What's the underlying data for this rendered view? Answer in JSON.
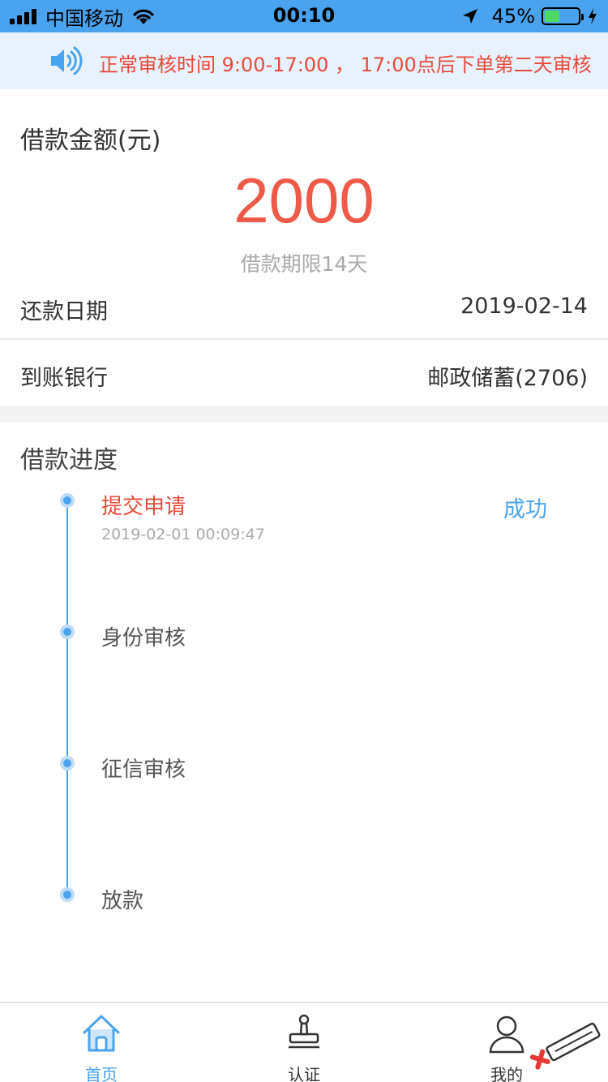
{
  "status_bar": {
    "carrier": "中国移动",
    "time": "00:10",
    "battery_percent": "45%",
    "battery_level": 0.45
  },
  "notice": {
    "text": "正常审核时间 9:00-17:00 ， 17:00点后下单第二天审核",
    "icon": "speaker-icon"
  },
  "loan": {
    "amount_label": "借款金额(元)",
    "amount": "2000",
    "term": "借款期限14天",
    "repay_label": "还款日期",
    "repay_date": "2019-02-14",
    "bank_label": "到账银行",
    "bank_value": "邮政储蓄(2706)"
  },
  "progress": {
    "title": "借款进度",
    "steps": [
      {
        "name": "提交申请",
        "time": "2019-02-01 00:09:47",
        "status": "成功"
      },
      {
        "name": "身份审核"
      },
      {
        "name": "征信审核"
      },
      {
        "name": "放款"
      }
    ]
  },
  "tabbar": {
    "items": [
      {
        "label": "首页",
        "icon": "home-icon"
      },
      {
        "label": "认证",
        "icon": "stamp-icon"
      },
      {
        "label": "我的",
        "icon": "user-icon"
      }
    ]
  },
  "colors": {
    "accent": "#4aa3ee",
    "amount": "#ef5a48",
    "notice_text": "#e84a3a"
  }
}
